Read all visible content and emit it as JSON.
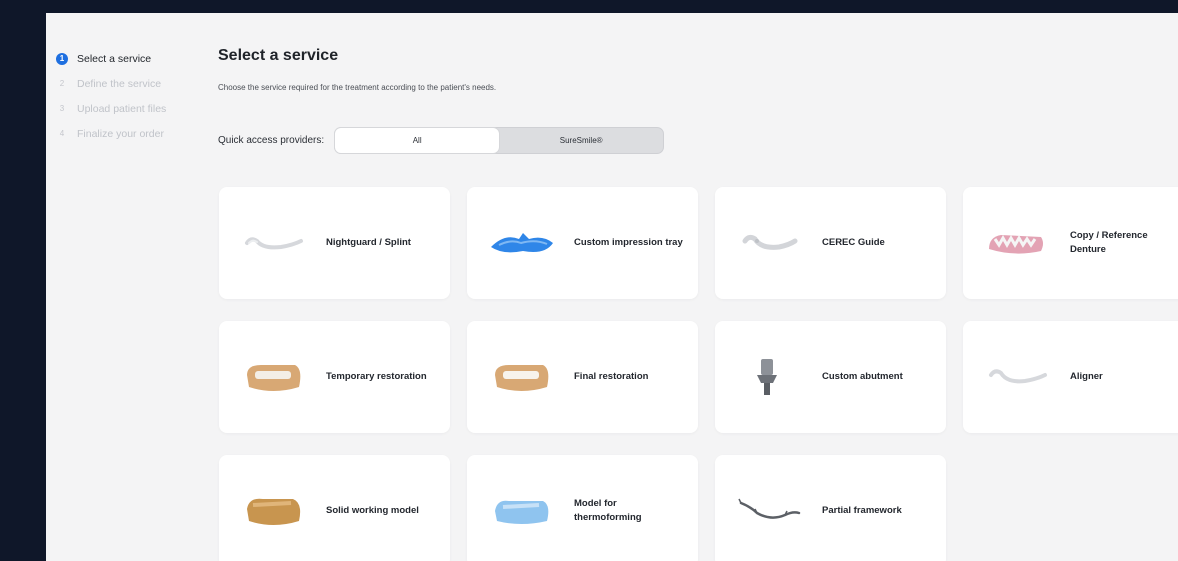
{
  "steps": [
    {
      "num": "1",
      "label": "Select a service",
      "active": true
    },
    {
      "num": "2",
      "label": "Define the service",
      "active": false
    },
    {
      "num": "3",
      "label": "Upload patient files",
      "active": false
    },
    {
      "num": "4",
      "label": "Finalize your order",
      "active": false
    }
  ],
  "main": {
    "title": "Select a service",
    "subtitle": "Choose the service required for the treatment according to the patient's needs.",
    "quick_access_label": "Quick access providers:",
    "providers": [
      {
        "label": "All",
        "selected": true
      },
      {
        "label": "SureSmile®",
        "selected": false
      }
    ]
  },
  "services": [
    {
      "label": "Nightguard / Splint",
      "icon": "nightguard-icon"
    },
    {
      "label": "Custom impression tray",
      "icon": "impression-tray-icon"
    },
    {
      "label": "CEREC Guide",
      "icon": "cerec-guide-icon"
    },
    {
      "label": "Copy / Reference Denture",
      "icon": "denture-icon"
    },
    {
      "label": "Temporary restoration",
      "icon": "temporary-restoration-icon"
    },
    {
      "label": "Final restoration",
      "icon": "final-restoration-icon"
    },
    {
      "label": "Custom abutment",
      "icon": "abutment-icon"
    },
    {
      "label": "Aligner",
      "icon": "aligner-icon"
    },
    {
      "label": "Solid working model",
      "icon": "working-model-icon"
    },
    {
      "label": "Model for thermoforming",
      "icon": "thermoforming-model-icon"
    },
    {
      "label": "Partial framework",
      "icon": "partial-framework-icon"
    }
  ],
  "colors": {
    "accent": "#1e6fe0",
    "tray_blue": "#2f86e8",
    "model_tan": "#d8a874",
    "model_blue": "#8fc4ef"
  }
}
